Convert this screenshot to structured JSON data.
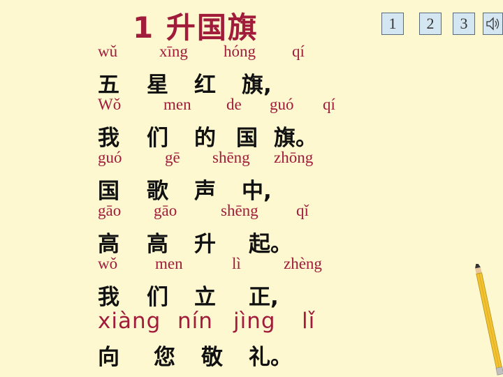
{
  "title": "1 升国旗",
  "nav": {
    "btn1": "1",
    "btn2": "2",
    "btn3": "3",
    "sound_icon": "speaker-icon"
  },
  "lines": [
    {
      "pinyin": [
        "wǔ",
        "xīng",
        "hóng",
        "qí"
      ],
      "hanzi": [
        "五",
        "星",
        "红",
        "旗,"
      ]
    },
    {
      "pinyin": [
        "Wǒ",
        "men",
        "de",
        "guó",
        "qí"
      ],
      "hanzi": [
        "我",
        "们",
        "的",
        "国",
        "旗。"
      ]
    },
    {
      "pinyin": [
        "guó",
        "gē",
        "shēng",
        "zhōng"
      ],
      "hanzi": [
        "国",
        "歌",
        "声",
        "中,"
      ]
    },
    {
      "pinyin": [
        "gāo",
        "gāo",
        "shēng",
        "qǐ"
      ],
      "hanzi": [
        "高",
        "高",
        "升",
        "起。"
      ]
    },
    {
      "pinyin": [
        "wǒ",
        "men",
        "lì",
        "zhèng"
      ],
      "hanzi": [
        "我",
        "们",
        "立",
        "正,"
      ]
    },
    {
      "pinyin_large": [
        "xiàng",
        "nín",
        "jìng",
        "lǐ"
      ],
      "hanzi": [
        "向",
        "您",
        "敬",
        "礼。"
      ]
    }
  ],
  "colors": {
    "background": "#fdf8d0",
    "pinyin": "#a01c3a",
    "hanzi": "#111111",
    "button": "#d4e6f2"
  }
}
